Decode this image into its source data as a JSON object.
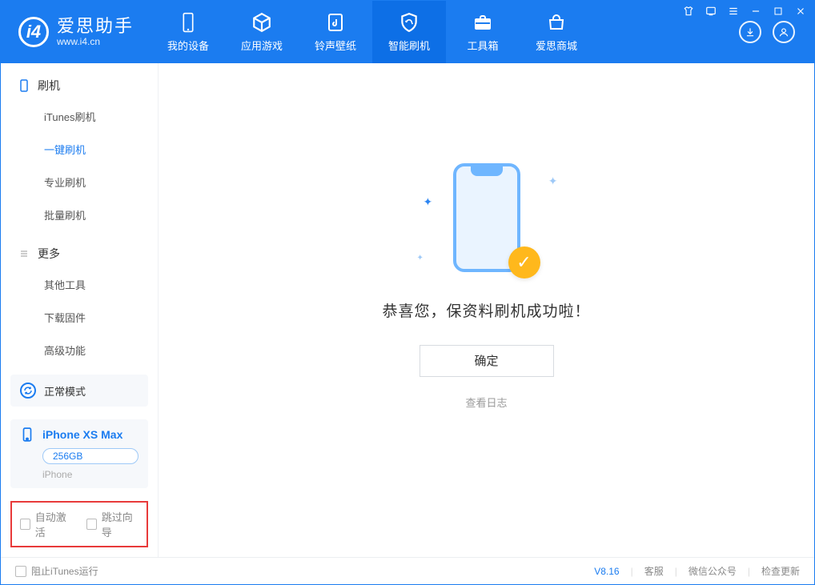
{
  "app": {
    "name": "爱思助手",
    "domain": "www.i4.cn"
  },
  "nav": {
    "items": [
      {
        "label": "我的设备"
      },
      {
        "label": "应用游戏"
      },
      {
        "label": "铃声壁纸"
      },
      {
        "label": "智能刷机"
      },
      {
        "label": "工具箱"
      },
      {
        "label": "爱思商城"
      }
    ],
    "active_index": 3
  },
  "sidebar": {
    "group1": {
      "title": "刷机",
      "items": [
        "iTunes刷机",
        "一键刷机",
        "专业刷机",
        "批量刷机"
      ],
      "active_index": 1
    },
    "group2": {
      "title": "更多",
      "items": [
        "其他工具",
        "下载固件",
        "高级功能"
      ]
    }
  },
  "mode": {
    "label": "正常模式"
  },
  "device": {
    "name": "iPhone XS Max",
    "capacity": "256GB",
    "type": "iPhone"
  },
  "bottom_options": {
    "auto_activate": "自动激活",
    "skip_guide": "跳过向导"
  },
  "main": {
    "success_text": "恭喜您，保资料刷机成功啦！",
    "ok_button": "确定",
    "view_log": "查看日志"
  },
  "footer": {
    "stop_itunes": "阻止iTunes运行",
    "version": "V8.16",
    "links": [
      "客服",
      "微信公众号",
      "检查更新"
    ]
  }
}
